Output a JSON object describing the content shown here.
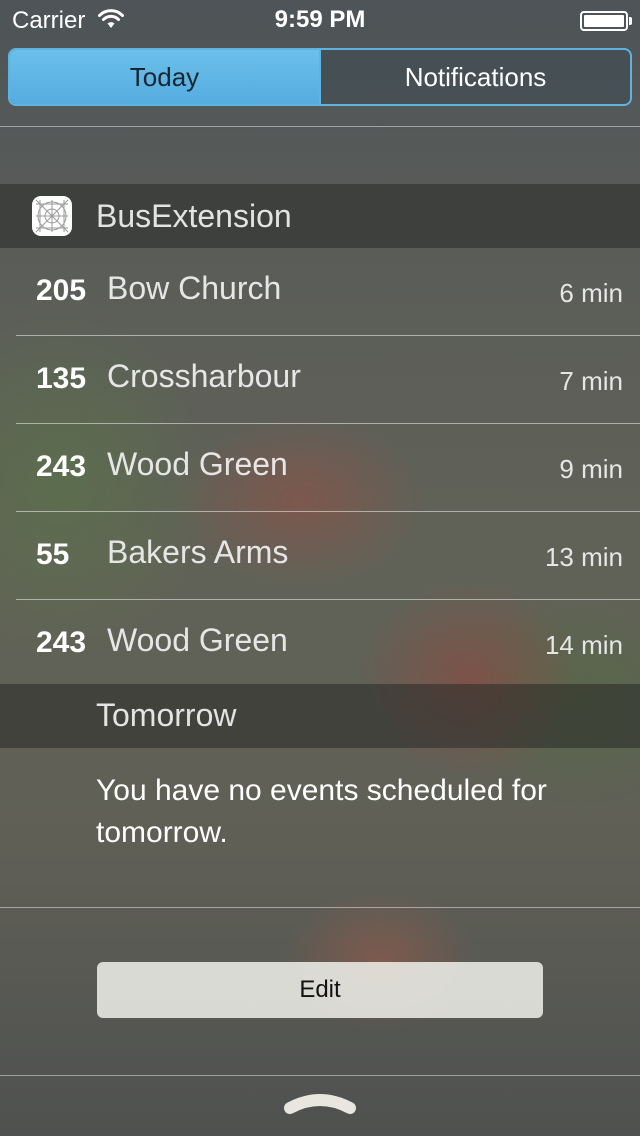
{
  "status_bar": {
    "carrier": "Carrier",
    "time": "9:59 PM"
  },
  "tabs": [
    {
      "label": "Today",
      "selected": true
    },
    {
      "label": "Notifications",
      "selected": false
    }
  ],
  "widget": {
    "title": "BusExtension",
    "rows": [
      {
        "route": "205",
        "destination": "Bow Church",
        "eta": "6 min"
      },
      {
        "route": "135",
        "destination": "Crossharbour",
        "eta": "7 min"
      },
      {
        "route": "243",
        "destination": "Wood Green",
        "eta": "9 min"
      },
      {
        "route": "55",
        "destination": "Bakers Arms",
        "eta": "13 min"
      },
      {
        "route": "243",
        "destination": "Wood Green",
        "eta": "14 min"
      }
    ]
  },
  "tomorrow": {
    "title": "Tomorrow",
    "message": "You have no events scheduled for tomorrow."
  },
  "edit_label": "Edit",
  "colors": {
    "accent": "#5fb3e0",
    "selected_tab_bg": "#6bc0ea"
  }
}
